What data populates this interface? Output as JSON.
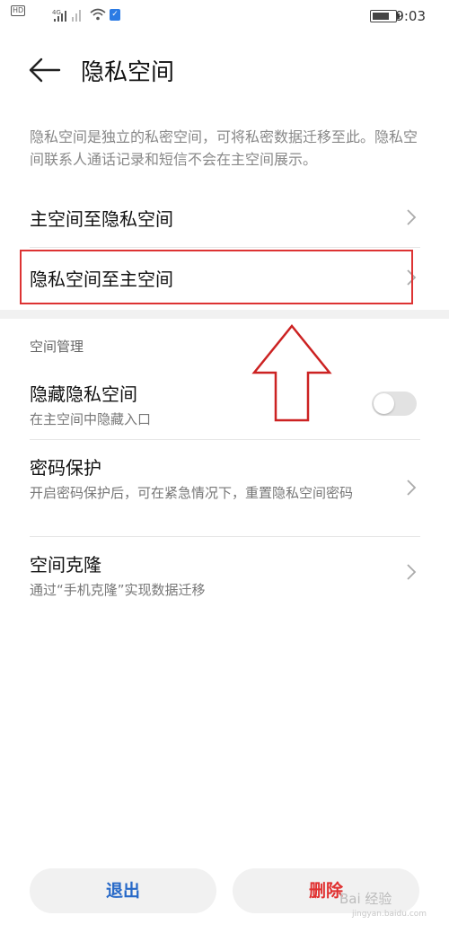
{
  "status_bar": {
    "hd_label": "HD",
    "network_label": "4G",
    "time": "9:03",
    "icons": [
      "signal-icon",
      "wifi-icon",
      "shield-icon",
      "battery-icon"
    ]
  },
  "header": {
    "title": "隐私空间",
    "back_icon": "back-arrow-icon"
  },
  "description": "隐私空间是独立的私密空间，可将私密数据迁移至此。隐私空间联系人通话记录和短信不会在主空间展示。",
  "migration_items": [
    {
      "title": "主空间至隐私空间"
    },
    {
      "title": "隐私空间至主空间"
    }
  ],
  "space_management": {
    "label": "空间管理",
    "hide_space": {
      "title": "隐藏隐私空间",
      "subtitle": "在主空间中隐藏入口",
      "enabled": false
    },
    "password_protect": {
      "title": "密码保护",
      "subtitle": "开启密码保护后，可在紧急情况下，重置隐私空间密码"
    },
    "space_clone": {
      "title": "空间克隆",
      "subtitle": "通过“手机克隆”实现数据迁移"
    }
  },
  "buttons": {
    "exit": "退出",
    "delete": "删除"
  },
  "watermark": {
    "text": "Bai 经验",
    "sub": "jingyan.baidu.com"
  },
  "colors": {
    "accent_blue": "#2769c8",
    "danger_red": "#e03030",
    "highlight": "#d33"
  }
}
